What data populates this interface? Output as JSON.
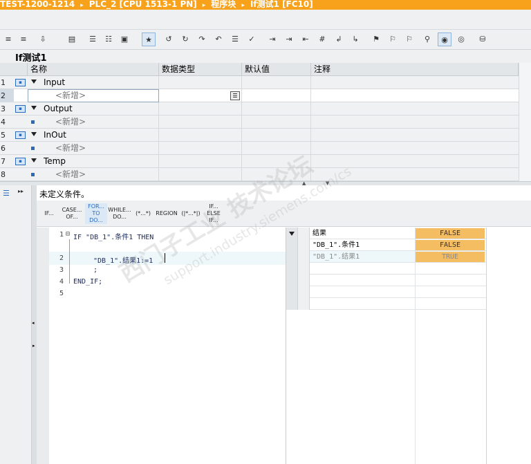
{
  "breadcrumb": [
    "TEST-1200-1214",
    "PLC_2 [CPU 1513-1 PN]",
    "程序块",
    "If测试1 [FC10]"
  ],
  "breadcrumb_sep": "▸",
  "block_title": "If测试1",
  "interface": {
    "headers": {
      "name": "名称",
      "datatype": "数据类型",
      "default": "默认值",
      "comment": "注释"
    },
    "rows": [
      {
        "num": "1",
        "label": "Input",
        "section": true
      },
      {
        "num": "2",
        "label": "<新增>",
        "section": false,
        "editing": true
      },
      {
        "num": "3",
        "label": "Output",
        "section": true
      },
      {
        "num": "4",
        "label": "<新增>",
        "section": false
      },
      {
        "num": "5",
        "label": "InOut",
        "section": true
      },
      {
        "num": "6",
        "label": "<新增>",
        "section": false
      },
      {
        "num": "7",
        "label": "Temp",
        "section": true
      },
      {
        "num": "8",
        "label": "<新增>",
        "section": false
      }
    ]
  },
  "warning": "未定义条件。",
  "templates": [
    {
      "label": "IF...",
      "highlighted": false
    },
    {
      "label": "CASE... OF...",
      "highlighted": false
    },
    {
      "label": "FOR... TO DO...",
      "highlighted": true
    },
    {
      "label": "WHILE... DO...",
      "highlighted": false
    },
    {
      "label": "(*...*)",
      "highlighted": false
    },
    {
      "label": "REGION",
      "highlighted": false
    },
    {
      "label": "(|*...*|)",
      "highlighted": false
    },
    {
      "label": "IF... ELSE IF...",
      "highlighted": false
    }
  ],
  "code_lines": [
    {
      "num": "1",
      "text": "IF \"DB_1\".条件1 THEN"
    },
    {
      "num": "2",
      "text": "\"DB_1\".结果1:=1"
    },
    {
      "num": "3",
      "text": ";"
    },
    {
      "num": "4",
      "text": "END_IF;"
    },
    {
      "num": "5",
      "text": ""
    }
  ],
  "fold_marker": "⊟",
  "watch": [
    {
      "name": "结果",
      "value": "FALSE"
    },
    {
      "name": "\"DB_1\".条件1",
      "value": "FALSE"
    },
    {
      "name": "\"DB_1\".结果1",
      "value": "TRUE"
    }
  ],
  "watermark": {
    "line1": "西门子工业 技术论坛",
    "line2": "support.industry.siemens.com/cs"
  },
  "colors": {
    "topbar": "#f7a21a",
    "watch_value": "#f5bd62",
    "accent": "#2a6ab8"
  }
}
